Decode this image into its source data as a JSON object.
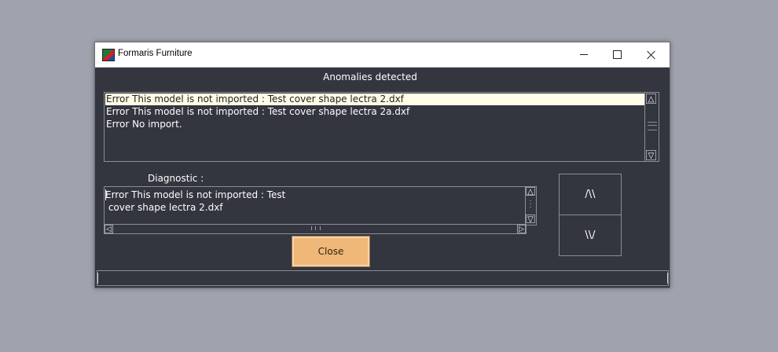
{
  "window": {
    "title": "Formaris Furniture"
  },
  "heading": "Anomalies detected",
  "anomalies": [
    "Error This model is not imported : Test cover shape lectra 2.dxf",
    "Error This model is not imported : Test cover shape lectra 2a.dxf",
    "Error No import."
  ],
  "diagnostic": {
    "label": "Diagnostic :",
    "lines": [
      "Error This model is not imported : Test",
      " cover shape lectra 2.dxf"
    ]
  },
  "buttons": {
    "close": "Close",
    "prev": "/\\\\",
    "next": "\\\\/"
  },
  "colors": {
    "window_bg": "#33353f",
    "selection_bg": "#fffbe6",
    "close_button": "#f0b878"
  }
}
